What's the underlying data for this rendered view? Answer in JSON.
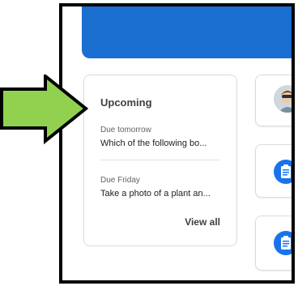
{
  "upcoming": {
    "title": "Upcoming",
    "items": [
      {
        "due": "Due tomorrow",
        "text": "Which of the following bo..."
      },
      {
        "due": "Due Friday",
        "text": "Take a photo of a plant an..."
      }
    ],
    "view_all": "View all"
  },
  "colors": {
    "banner": "#1a6fd1",
    "accent": "#1a73e8",
    "arrow_fill": "#92d050"
  },
  "icons": [
    "user-avatar-icon",
    "assignment-icon"
  ]
}
